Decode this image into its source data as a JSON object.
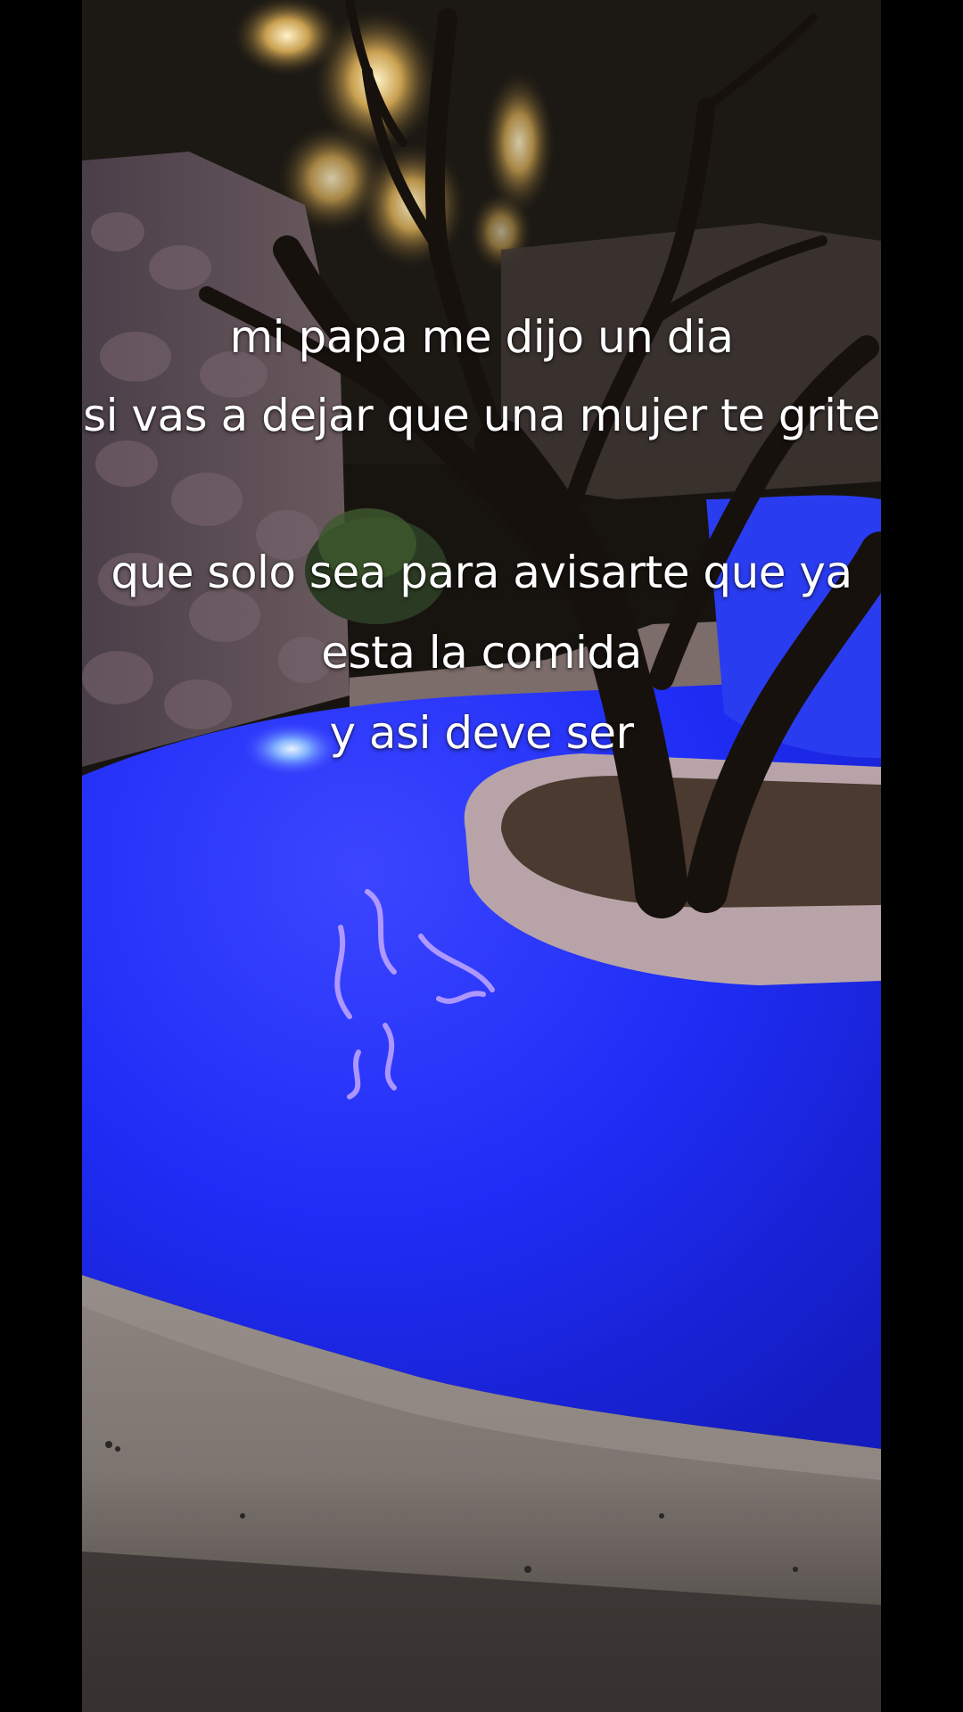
{
  "video": {
    "scene": "night-pool-tree"
  },
  "overlay": {
    "lines": [
      "mi papa me dijo un dia",
      "si vas a dejar que una mujer te grite",
      "que solo sea para avisarte que ya",
      "esta la comida",
      "y asi deve ser"
    ]
  },
  "colors": {
    "pool": "#1f2dff",
    "caption": "#ffffff",
    "letterbox": "#000000"
  }
}
